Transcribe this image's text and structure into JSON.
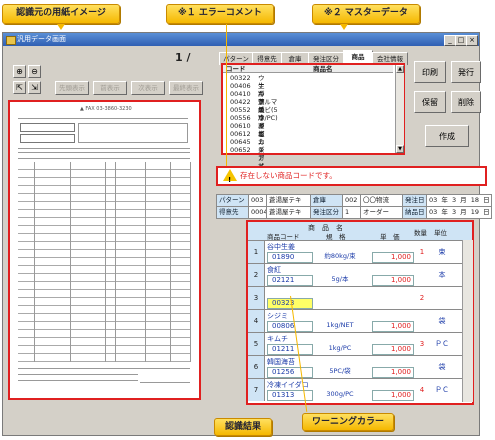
{
  "window": {
    "title": "汎用データ画面",
    "page_number": "1 /"
  },
  "callouts": {
    "scan_image": "認識元の用紙イメージ",
    "error_comment": "※１ エラーコメント",
    "master_data": "※２ マスターデータ",
    "result": "認識結果",
    "warning_color": "ワーニングカラー"
  },
  "nav_buttons": [
    "先頭表示",
    "前表示",
    "次表示",
    "最終表示"
  ],
  "tabs": [
    "パターン",
    "得意先",
    "倉庫",
    "発注区分",
    "商品",
    "会社情報"
  ],
  "active_tab": "商品",
  "master": {
    "columns": [
      "コード",
      "商品名"
    ],
    "rows": [
      [
        "00322",
        "ウナギ蒲焼"
      ],
      [
        "00406",
        "生わかめ"
      ],
      [
        "00410",
        "冷アサリガニ"
      ],
      [
        "00422",
        "クルマエビ(5本/PC)"
      ],
      [
        "00552",
        "ズワイガニ"
      ],
      [
        "00556",
        "冷凍イカ"
      ],
      [
        "00610",
        "シジミ"
      ],
      [
        "00612",
        "塩カキ"
      ],
      [
        "00645",
        "ニシガイ"
      ],
      [
        "00652",
        "ズアサリ"
      ]
    ]
  },
  "action_buttons": {
    "print": "印刷",
    "issue": "発行",
    "save": "保留",
    "delete": "削除",
    "create": "作成"
  },
  "error_message": "存在しない商品コードです。",
  "info": {
    "row1": {
      "pattern_label": "パターン",
      "pattern_code": "003",
      "pattern_name": "蒼湯屋テキ",
      "warehouse_label": "倉庫",
      "warehouse_code": "002",
      "warehouse_name": "〇〇物流",
      "order_date_label": "発注日",
      "order_year": "03",
      "order_month": "3",
      "order_day": "18",
      "y": "年",
      "m": "月",
      "d": "日"
    },
    "row2": {
      "customer_label": "得意先",
      "customer_code": "0004",
      "customer_name": "蒼湯屋テキ",
      "order_type_label": "発注区分",
      "order_type_code": "1",
      "order_type_name": "オーダー",
      "delivery_label": "納品日",
      "delivery_year": "03",
      "delivery_month": "3",
      "delivery_day": "19",
      "y": "年",
      "m": "月",
      "d": "日"
    }
  },
  "result": {
    "header": {
      "name": "商　品　名",
      "code": "商品コード",
      "spec": "規　格",
      "price": "単　価",
      "qty": "数量",
      "unit": "単位"
    },
    "rows": [
      {
        "no": "1",
        "name": "谷中生姜",
        "code": "01890",
        "spec": "約80kg/束",
        "price": "1,000",
        "qty": "1",
        "unit": "束"
      },
      {
        "no": "2",
        "name": "食紅",
        "code": "02121",
        "spec": "5g/本",
        "price": "1,000",
        "qty": "",
        "unit": "本"
      },
      {
        "no": "3",
        "name": "",
        "code": "00323",
        "spec": "",
        "price": "",
        "qty": "2",
        "unit": ""
      },
      {
        "no": "4",
        "name": "シジミ",
        "code": "00806",
        "spec": "1kg/NET",
        "price": "1,000",
        "qty": "",
        "unit": "袋"
      },
      {
        "no": "5",
        "name": "キムチ",
        "code": "01211",
        "spec": "1kg/PC",
        "price": "1,000",
        "qty": "3",
        "unit": "ＰＣ"
      },
      {
        "no": "6",
        "name": "韓国海苔",
        "code": "01256",
        "spec": "5PC/袋",
        "price": "1,000",
        "qty": "",
        "unit": "袋"
      },
      {
        "no": "7",
        "name": "冷凍イイダコ",
        "code": "01313",
        "spec": "300g/PC",
        "price": "1,000",
        "qty": "4",
        "unit": "ＰＣ"
      }
    ]
  },
  "colors": {
    "highlight_red": "#e02020",
    "warning_yellow": "#ffff66",
    "callout": "#f5b800",
    "label_blue": "#cfe4f5"
  }
}
